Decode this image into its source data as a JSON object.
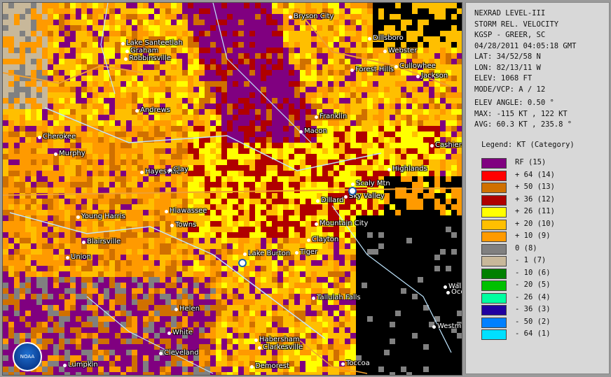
{
  "info": {
    "lines": [
      "NEXRAD LEVEL-III",
      "STORM REL. VELOCITY",
      "KGSP - GREER, SC",
      "04/28/2011 04:05:18 GMT",
      "LAT: 34/52/58 N",
      "LON: 82/13/11 W",
      "ELEV: 1068 FT",
      "MODE/VCP: A / 12"
    ],
    "lines2": [
      "ELEV ANGLE: 0.50 °",
      "MAX: -115 KT , 122 KT",
      "AVG: 60.3 KT , 235.8 °"
    ]
  },
  "legend": {
    "title": "Legend: KT (Category)",
    "items": [
      {
        "label": "RF (15)",
        "color": "#800080"
      },
      {
        "label": "+ 64 (14)",
        "color": "#ff0000"
      },
      {
        "label": "+ 50 (13)",
        "color": "#d07000"
      },
      {
        "label": "+ 36 (12)",
        "color": "#b00000"
      },
      {
        "label": "+ 26 (11)",
        "color": "#ffff00"
      },
      {
        "label": "+ 20 (10)",
        "color": "#ffbf00"
      },
      {
        "label": "+ 10 (9)",
        "color": "#ff9a00"
      },
      {
        "label": "0 (8)",
        "color": "#808080"
      },
      {
        "label": "- 1 (7)",
        "color": "#c8b89a"
      },
      {
        "label": "- 10 (6)",
        "color": "#008000"
      },
      {
        "label": "- 20 (5)",
        "color": "#00c000"
      },
      {
        "label": "- 26 (4)",
        "color": "#00ffa0"
      },
      {
        "label": "- 36 (3)",
        "color": "#2000a0"
      },
      {
        "label": "- 50 (2)",
        "color": "#0080ff"
      },
      {
        "label": "- 64 (1)",
        "color": "#00e0ff"
      }
    ]
  },
  "cities": [
    "Bryson City",
    "Dillsboro",
    "Webster",
    "Lake Santeetlah",
    "Graham",
    "Robbinsville",
    "Forest Hills",
    "Cullowhee",
    "Jackson",
    "Andrews",
    "Franklin",
    "Macon",
    "Cherokee",
    "Cashiers",
    "Murphy",
    "Hayesville",
    "Clay",
    "Highlands",
    "Scaly Mtn",
    "Sky Valley",
    "Dillard",
    "Hiawassee",
    "Young Harris",
    "Towns",
    "Mountain City",
    "Clayton",
    "Blairsville",
    "Lake Burton",
    "Tiger",
    "Union",
    "Tallulah Falls",
    "Walhalla",
    "Oconee",
    "Helen",
    "Westminster",
    "White",
    "Habersham",
    "Clarkesville",
    "Cleveland",
    "Demorest",
    "Lumpkin",
    "Toccoa"
  ],
  "logo": "NOAA"
}
